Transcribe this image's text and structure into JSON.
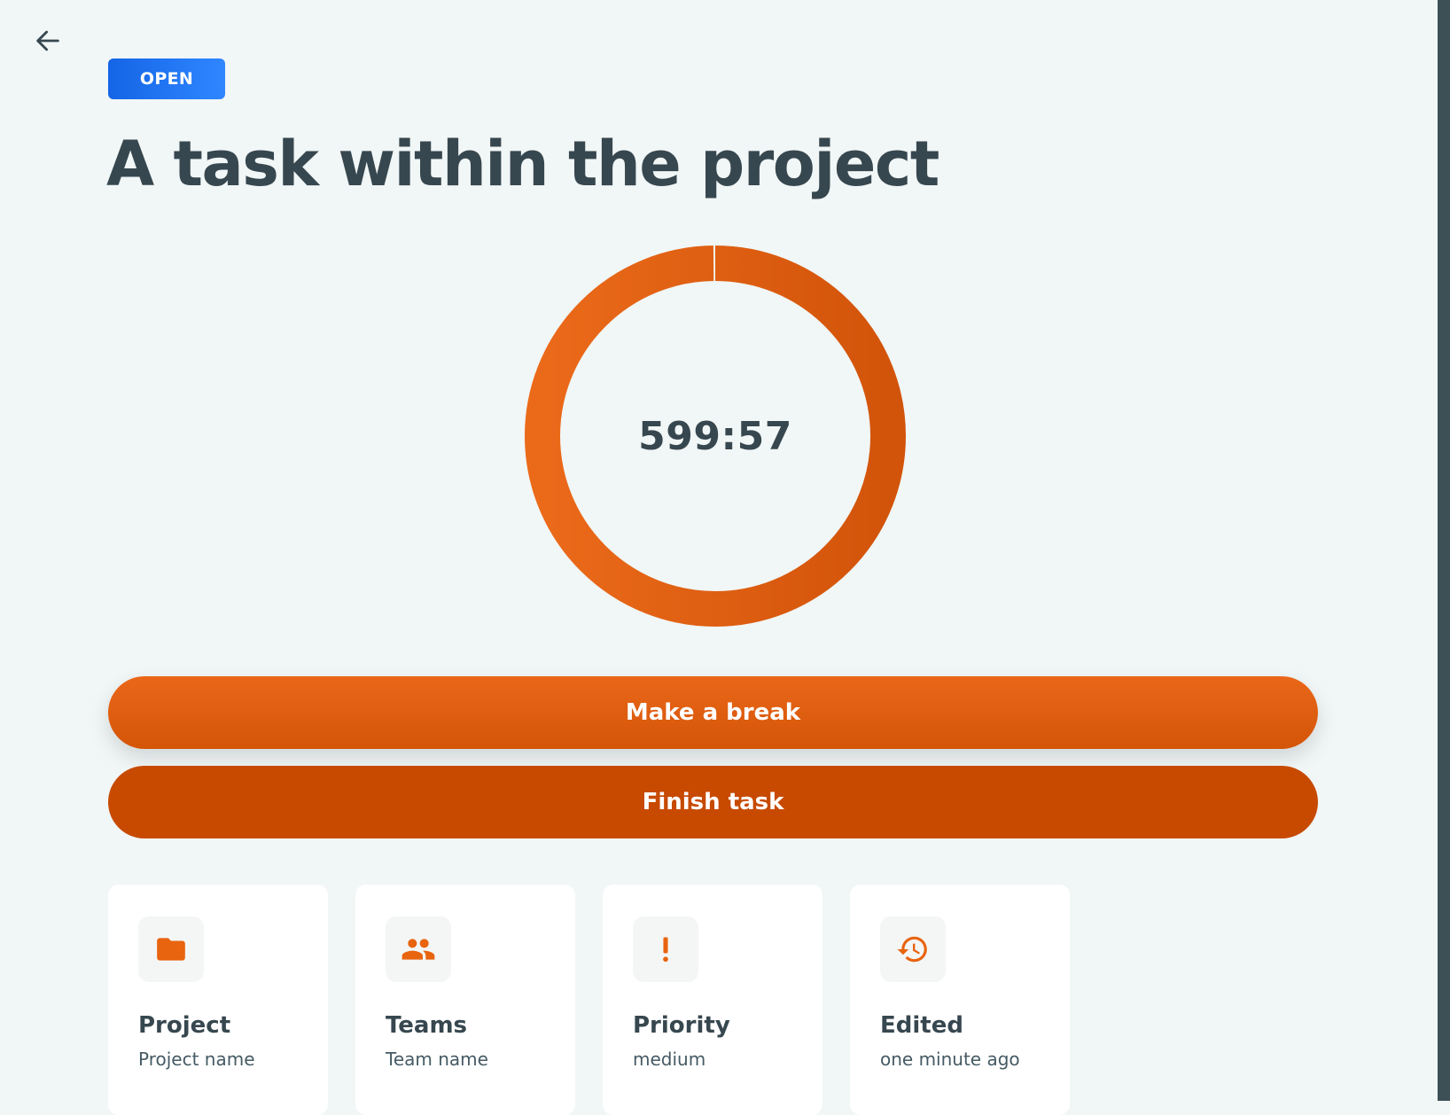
{
  "status": {
    "label": "OPEN",
    "color": "#1f6fee"
  },
  "task": {
    "title": "A task within the project"
  },
  "timer": {
    "display": "599:57",
    "progress": 0.998,
    "ring_color": "#e15f10"
  },
  "actions": {
    "break_label": "Make a break",
    "finish_label": "Finish task"
  },
  "info_cards": [
    {
      "icon": "folder-icon",
      "title": "Project",
      "value": "Project name"
    },
    {
      "icon": "people-icon",
      "title": "Teams",
      "value": "Team name"
    },
    {
      "icon": "exclamation-icon",
      "title": "Priority",
      "value": "medium"
    },
    {
      "icon": "history-icon",
      "title": "Edited",
      "value": "one minute ago"
    }
  ],
  "colors": {
    "accent": "#e8640f",
    "accent_dark": "#c74a00",
    "text": "#37474f",
    "background": "#f1f6f6"
  }
}
